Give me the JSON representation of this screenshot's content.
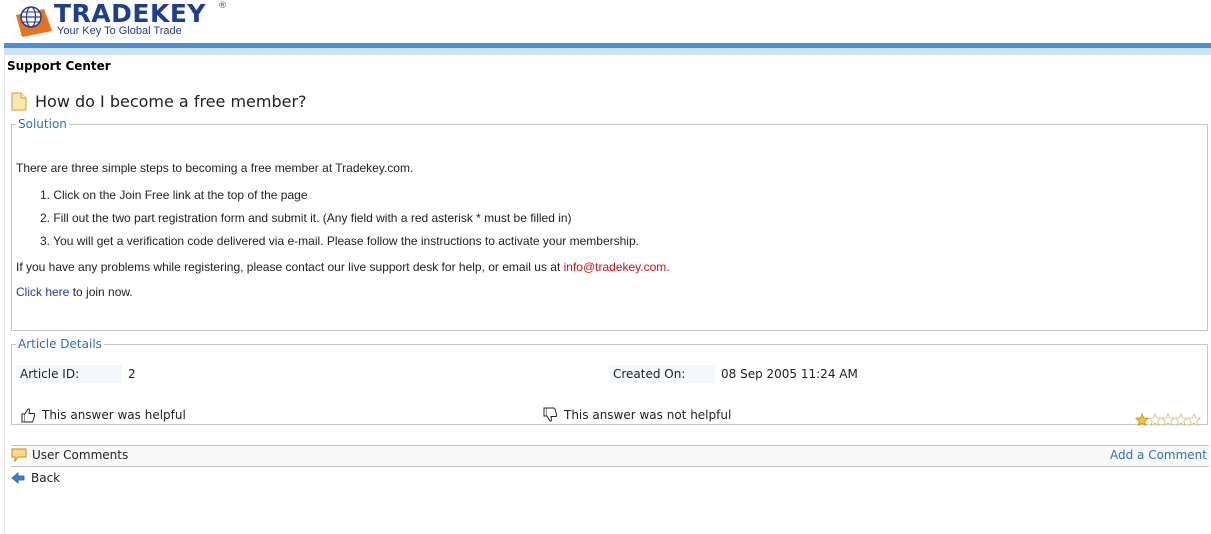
{
  "brand": {
    "name": "TRADEKEY",
    "registered": "®",
    "tagline": "Your Key To Global Trade",
    "colors": {
      "primary": "#1e3f8f",
      "accent": "#e8731a",
      "bar": "#4a90d9"
    }
  },
  "page": {
    "section_title": "Support Center",
    "question_title": "How do I become a free member?"
  },
  "solution": {
    "legend": "Solution",
    "intro": "There are three simple steps to becoming a free member at Tradekey.com.",
    "steps": [
      "1. Click on the Join Free link at the top of the page",
      "2. Fill out the two part registration form and submit it. (Any field with a red asterisk * must be filled in)",
      "3. You will get a verification code delivered via e-mail. Please follow the instructions to activate your membership."
    ],
    "problems_text": "If you have any problems while registering, please contact our live support desk for help, or email us at ",
    "email": "info@tradekey.com",
    "email_suffix": ".",
    "join_link": "Click here",
    "join_suffix": " to join now."
  },
  "details": {
    "legend": "Article Details",
    "article_id_label": "Article ID:",
    "article_id": "2",
    "created_label": "Created On:",
    "created": "08 Sep 2005 11:24 AM",
    "helpful": "This answer was helpful",
    "not_helpful": "This answer was not helpful",
    "rating": {
      "value": 1,
      "max": 5
    }
  },
  "comments": {
    "label": "User Comments",
    "add": "Add a Comment"
  },
  "nav": {
    "back": "Back"
  },
  "icons": {
    "logo": "globe-key-icon",
    "doc": "document-icon",
    "thumbs_up": "thumbs-up-icon",
    "thumbs_down": "thumbs-down-icon",
    "comment": "comment-icon",
    "back": "back-arrow-icon",
    "star": "star-icon"
  }
}
